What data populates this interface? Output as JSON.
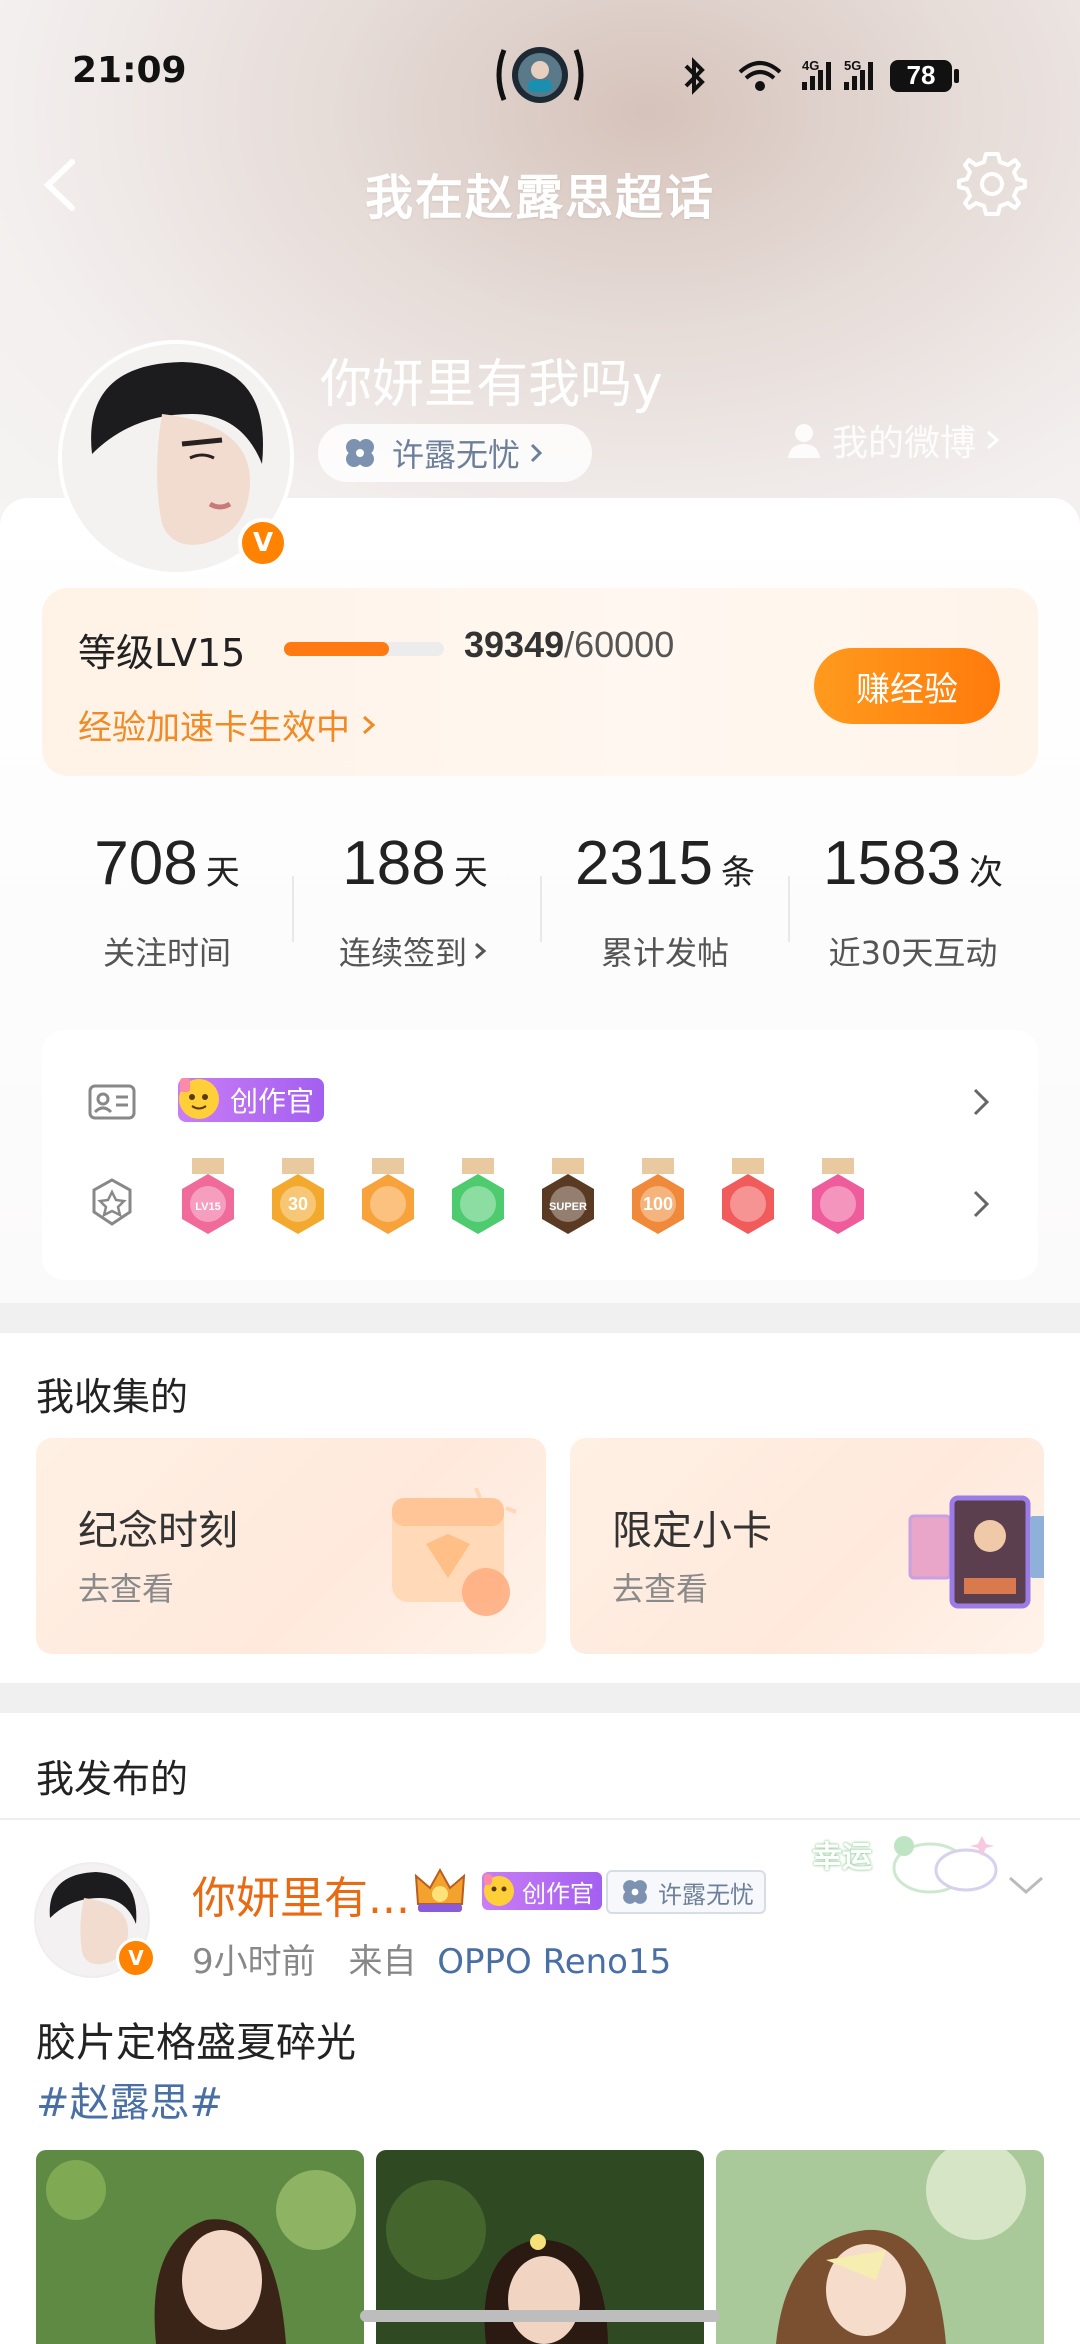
{
  "status_bar": {
    "time": "21:09",
    "battery": "78"
  },
  "header": {
    "title": "我在赵露思超话"
  },
  "profile": {
    "nickname": "你妍里有我吗y",
    "badge_label": "许露无忧",
    "my_weibo_link": "我的微博",
    "verified_mark": "V"
  },
  "level": {
    "label": "等级LV15",
    "progress": 0.656,
    "exp_current": "39349",
    "exp_total": "/60000",
    "boost_text": "经验加速卡生效中",
    "earn_button": "赚经验"
  },
  "stats": [
    {
      "value": "708",
      "unit": "天",
      "label": "关注时间"
    },
    {
      "value": "188",
      "unit": "天",
      "label": "连续签到"
    },
    {
      "value": "2315",
      "unit": "条",
      "label": "累计发帖"
    },
    {
      "value": "1583",
      "unit": "次",
      "label": "近30天互动"
    }
  ],
  "identity": {
    "tag": "创作官"
  },
  "medals": [
    {
      "text": "LV15",
      "color": "#f06a9a"
    },
    {
      "text": "30",
      "color": "#f3a92d"
    },
    {
      "text": "",
      "color": "#f7a23a"
    },
    {
      "text": "",
      "color": "#4ecb6f"
    },
    {
      "text": "SUPER",
      "color": "#5a3a22"
    },
    {
      "text": "100",
      "color": "#f08a3a"
    },
    {
      "text": "",
      "color": "#f25b5b"
    },
    {
      "text": "",
      "color": "#ef5c9b"
    }
  ],
  "collected": {
    "title": "我收集的",
    "cards": [
      {
        "title": "纪念时刻",
        "action": "去查看"
      },
      {
        "title": "限定小卡",
        "action": "去查看"
      }
    ]
  },
  "published": {
    "title": "我发布的",
    "post": {
      "author": "你妍里有...",
      "creator_tag": "创作官",
      "group_tag": "许露无忧",
      "sticker_text": "幸运",
      "time": "9小时前",
      "source_prefix": "来自",
      "device": "OPPO Reno15",
      "text": "胶片定格盛夏碎光",
      "hashtag": "#赵露思#"
    }
  },
  "colors": {
    "accent": "#ff8200",
    "link": "#4a6fa5",
    "orange_text": "#f08a24"
  }
}
